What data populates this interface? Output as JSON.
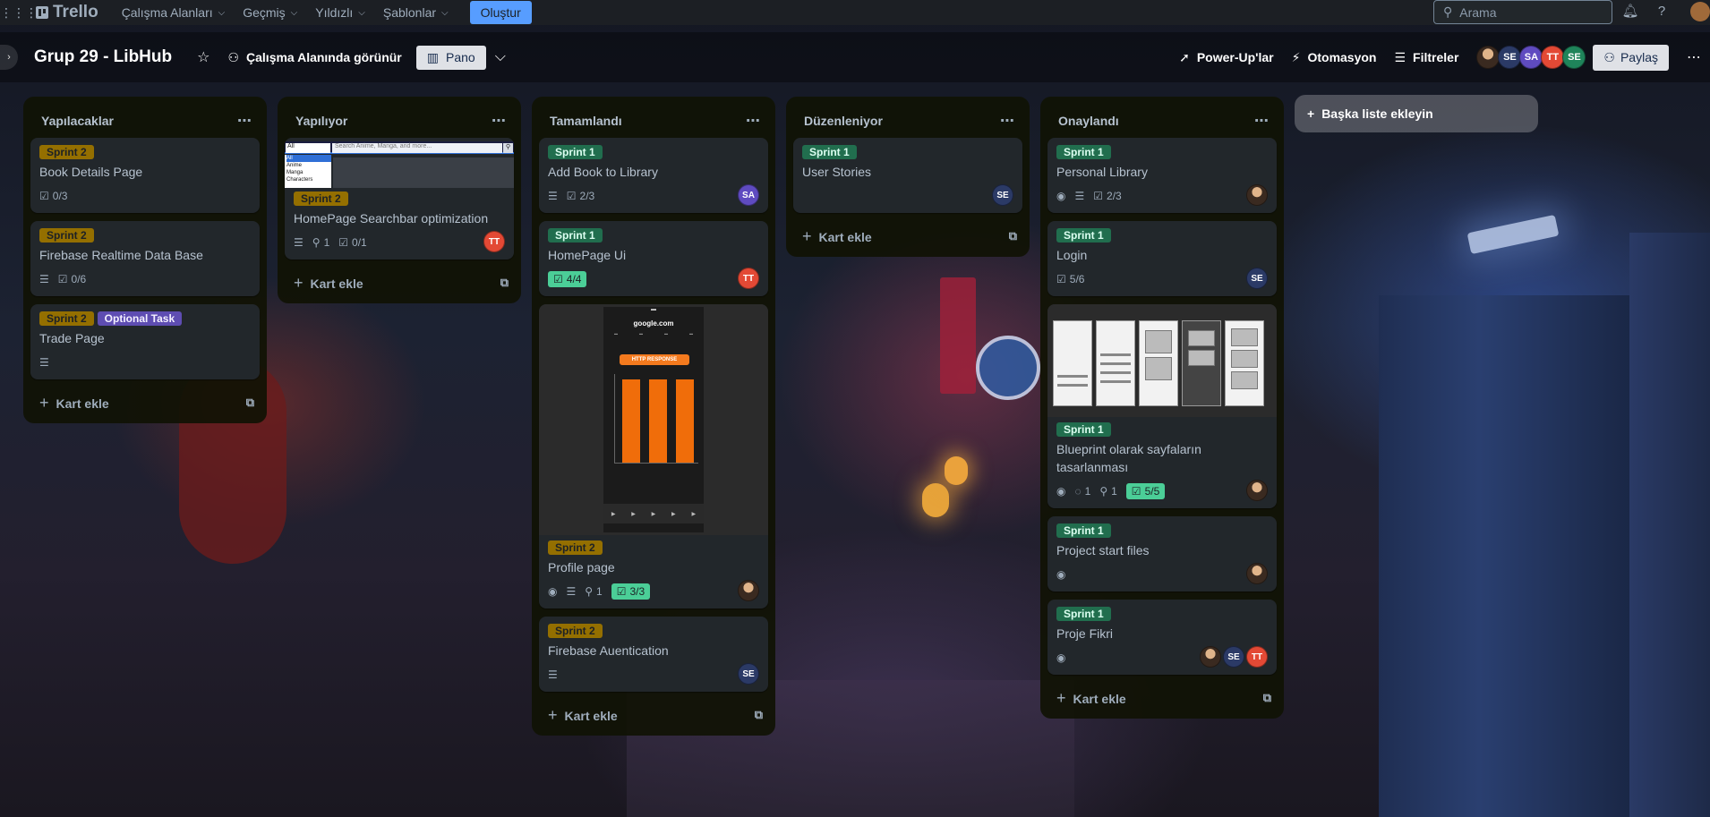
{
  "topnav": {
    "logo": "Trello",
    "menus": [
      "Çalışma Alanları",
      "Geçmiş",
      "Yıldızlı",
      "Şablonlar"
    ],
    "create": "Oluştur",
    "search_placeholder": "Arama"
  },
  "board": {
    "title": "Grup 29 - LibHub",
    "visibility": "Çalışma Alanında görünür",
    "view": "Pano",
    "powerups": "Power-Up'lar",
    "automation": "Otomasyon",
    "filters": "Filtreler",
    "share": "Paylaş",
    "members": [
      "SE",
      "SA",
      "TT",
      "SE"
    ]
  },
  "add_card_label": "Kart ekle",
  "add_list_label": "Başka liste ekleyin",
  "lists": [
    {
      "title": "Yapılacaklar",
      "cards": [
        {
          "labels": [
            "Sprint 2"
          ],
          "title": "Book Details Page",
          "checklist": "0/3"
        },
        {
          "labels": [
            "Sprint 2"
          ],
          "title": "Firebase Realtime Data Base",
          "checklist": "0/6"
        },
        {
          "labels": [
            "Sprint 2",
            "Optional Task"
          ],
          "title": "Trade Page"
        }
      ]
    },
    {
      "title": "Yapılıyor",
      "cards": [
        {
          "labels": [
            "Sprint 2"
          ],
          "title": "HomePage Searchbar optimization",
          "attachments": "1",
          "checklist": "0/1",
          "member": "TT",
          "cover": {
            "select": "All",
            "placeholder": "Search Anime, Manga, and more...",
            "options": [
              "All",
              "Anime",
              "Manga",
              "Characters"
            ]
          }
        }
      ]
    },
    {
      "title": "Tamamlandı",
      "cards": [
        {
          "labels": [
            "Sprint 1"
          ],
          "title": "Add Book to Library",
          "checklist": "2/3",
          "member": "SA"
        },
        {
          "labels": [
            "Sprint 1"
          ],
          "title": "HomePage Ui",
          "checklist": "4/4",
          "member": "TT"
        },
        {
          "labels": [
            "Sprint 2"
          ],
          "title": "Profile page",
          "attachments": "1",
          "checklist": "3/3",
          "cover": {
            "url": "google.com",
            "button": "HTTP RESPONSE"
          }
        },
        {
          "labels": [
            "Sprint 2"
          ],
          "title": "Firebase Auentication",
          "member": "SE"
        }
      ]
    },
    {
      "title": "Düzenleniyor",
      "cards": [
        {
          "labels": [
            "Sprint 1"
          ],
          "title": "User Stories",
          "member": "SE"
        }
      ]
    },
    {
      "title": "Onaylandı",
      "cards": [
        {
          "labels": [
            "Sprint 1"
          ],
          "title": "Personal Library",
          "checklist": "2/3"
        },
        {
          "labels": [
            "Sprint 1"
          ],
          "title": "Login",
          "checklist": "5/6",
          "member": "SE"
        },
        {
          "labels": [
            "Sprint 1"
          ],
          "title": "Blueprint olarak sayfaların tasarlanması",
          "comments": "1",
          "attachments": "1",
          "checklist": "5/5"
        },
        {
          "labels": [
            "Sprint 1"
          ],
          "title": "Project start files"
        },
        {
          "labels": [
            "Sprint 1"
          ],
          "title": "Proje Fikri",
          "members": [
            "SE",
            "TT"
          ]
        }
      ]
    }
  ],
  "colors": {
    "sprint2": "#946f00",
    "sprint1": "#216e4e",
    "optional": "#5e4db2",
    "checklist_done": "#4bce97",
    "create_button": "#579dff"
  }
}
